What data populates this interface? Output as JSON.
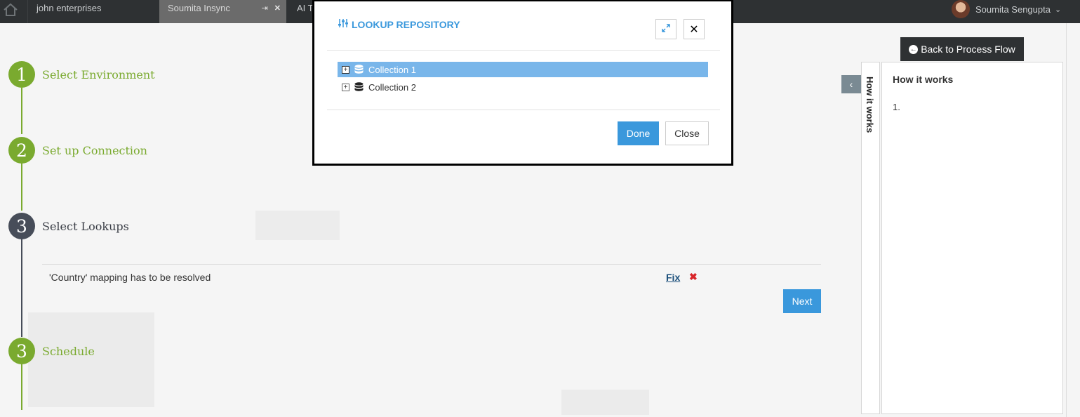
{
  "topbar": {
    "tabs": [
      {
        "label": "john enterprises"
      },
      {
        "label": "Soumita Insync",
        "pin": "⇥",
        "close": "✕"
      },
      {
        "label": "AI T"
      }
    ],
    "user_name": "Soumita Sengupta",
    "user_chevron": "⌄"
  },
  "steps": [
    {
      "number": "1",
      "label": "Select Environment",
      "state": "complete"
    },
    {
      "number": "2",
      "label": "Set up Connection",
      "state": "complete"
    },
    {
      "number": "3",
      "label": "Select Lookups",
      "state": "active"
    },
    {
      "number": "3",
      "label": "Schedule",
      "state": "complete"
    }
  ],
  "mapping": {
    "message": "'Country' mapping has to be resolved",
    "fix_label": "Fix",
    "remove_glyph": "✖"
  },
  "next_label": "Next",
  "back_label": "Back to Process Flow",
  "how_it_works": {
    "tab_label": "How it works",
    "title": "How it works",
    "items": [
      "1."
    ]
  },
  "modal": {
    "title": "LOOKUP REPOSITORY",
    "close_glyph": "✕",
    "tree": [
      {
        "label": "Collection 1",
        "selected": true
      },
      {
        "label": "Collection 2",
        "selected": false
      }
    ],
    "done_label": "Done",
    "close_label": "Close"
  },
  "colors": {
    "accent": "#3a98dc",
    "step_green": "#7aaa2f",
    "step_dark": "#474d59",
    "selected_row": "#79b6ea",
    "error_red": "#d9252a"
  }
}
